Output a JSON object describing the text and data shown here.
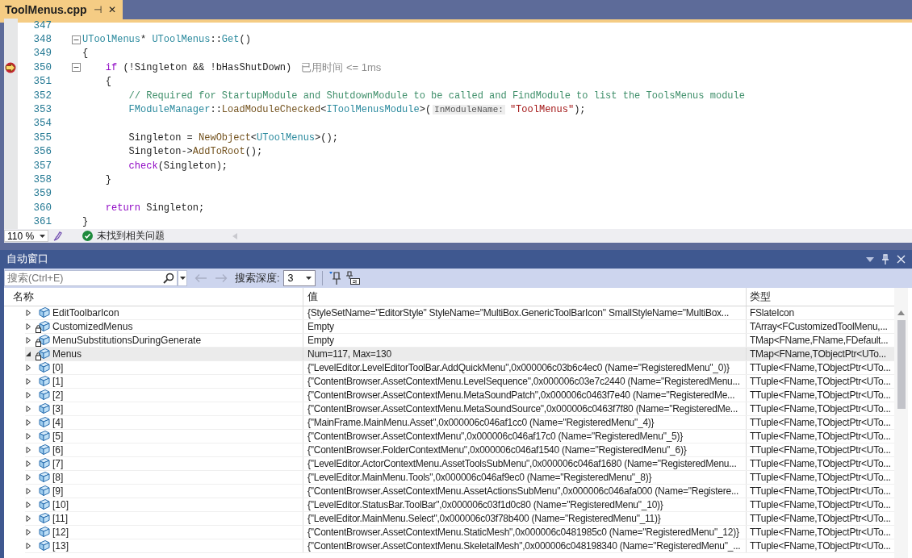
{
  "tab": {
    "title": "ToolMenus.cpp",
    "pin": "⊣",
    "close": "✕",
    "selected": true
  },
  "code": {
    "lines": [
      {
        "number": "347",
        "fold": false,
        "breakpoint": false
      },
      {
        "number": "348",
        "fold": true,
        "breakpoint": false,
        "tokens": [
          {
            "text": "UToolMenus",
            "kind": "type"
          },
          {
            "text": "* ",
            "kind": "plain"
          },
          {
            "text": "UToolMenus",
            "kind": "type"
          },
          {
            "text": "::",
            "kind": "plain"
          },
          {
            "text": "Get",
            "kind": "type"
          },
          {
            "text": "()",
            "kind": "plain"
          }
        ]
      },
      {
        "number": "349",
        "fold": false,
        "breakpoint": false,
        "tokens": [
          {
            "text": "{",
            "kind": "plain"
          }
        ]
      },
      {
        "number": "350",
        "fold": true,
        "breakpoint": true,
        "tokens": [
          {
            "text": "\tif",
            "kind": "keyword"
          },
          {
            "text": " (!Singleton && !bHasShutDown)",
            "kind": "plain"
          },
          {
            "text": "已用时间 <= 1ms",
            "kind": "timing"
          }
        ]
      },
      {
        "number": "351",
        "fold": false,
        "breakpoint": false,
        "tokens": [
          {
            "text": "\t{",
            "kind": "plain"
          }
        ]
      },
      {
        "number": "352",
        "fold": false,
        "breakpoint": false,
        "tokens": [
          {
            "text": "\t\t// Required for StartupModule and ShutdownModule to be called and FindModule to list the ToolsMenus module",
            "kind": "comment"
          }
        ]
      },
      {
        "number": "353",
        "fold": false,
        "breakpoint": false,
        "tokens": [
          {
            "text": "\t\tFModuleManager",
            "kind": "type"
          },
          {
            "text": "::",
            "kind": "plain"
          },
          {
            "text": "LoadModuleChecked",
            "kind": "func"
          },
          {
            "text": "<",
            "kind": "plain"
          },
          {
            "text": "IToolMenusModule",
            "kind": "type"
          },
          {
            "text": ">(",
            "kind": "plain"
          },
          {
            "text": "InModuleName:",
            "kind": "hint"
          },
          {
            "text": "\"ToolMenus\"",
            "kind": "string"
          },
          {
            "text": ");",
            "kind": "plain"
          }
        ]
      },
      {
        "number": "354",
        "fold": false,
        "breakpoint": false
      },
      {
        "number": "355",
        "fold": false,
        "breakpoint": false,
        "tokens": [
          {
            "text": "\t\tSingleton = ",
            "kind": "plain"
          },
          {
            "text": "NewObject",
            "kind": "func"
          },
          {
            "text": "<",
            "kind": "plain"
          },
          {
            "text": "UToolMenus",
            "kind": "type"
          },
          {
            "text": ">();",
            "kind": "plain"
          }
        ]
      },
      {
        "number": "356",
        "fold": false,
        "breakpoint": false,
        "tokens": [
          {
            "text": "\t\tSingleton->",
            "kind": "plain"
          },
          {
            "text": "AddToRoot",
            "kind": "func"
          },
          {
            "text": "();",
            "kind": "plain"
          }
        ]
      },
      {
        "number": "357",
        "fold": false,
        "breakpoint": false,
        "tokens": [
          {
            "text": "\t\tcheck",
            "kind": "keyword"
          },
          {
            "text": "(Singleton);",
            "kind": "plain"
          }
        ]
      },
      {
        "number": "358",
        "fold": false,
        "breakpoint": false,
        "tokens": [
          {
            "text": "\t}",
            "kind": "plain"
          }
        ]
      },
      {
        "number": "359",
        "fold": false,
        "breakpoint": false
      },
      {
        "number": "360",
        "fold": false,
        "breakpoint": false,
        "tokens": [
          {
            "text": "\treturn",
            "kind": "keyword"
          },
          {
            "text": " Singleton;",
            "kind": "plain"
          }
        ]
      },
      {
        "number": "361",
        "fold": false,
        "breakpoint": false,
        "tokens": [
          {
            "text": "}",
            "kind": "plain"
          }
        ]
      }
    ]
  },
  "editor_status": {
    "zoom": "110 %",
    "message": "未找到相关问题"
  },
  "auto_window": {
    "title": "自动窗口",
    "search": {
      "placeholder": "搜索(Ctrl+E)"
    },
    "depth_label": "搜索深度:",
    "depth": "3",
    "columns": [
      "名称",
      "值",
      "类型"
    ],
    "rows": [
      {
        "name": "EditToolbarIcon",
        "value": "{StyleSetName=\"EditorStyle\" StyleName=\"MultiBox.GenericToolBarIcon\" SmallStyleName=\"MultiBox...",
        "type": "FSlateIcon",
        "locked": false,
        "expanded": false,
        "selected": false
      },
      {
        "name": "CustomizedMenus",
        "value": "Empty",
        "type": "TArray<FCustomizedToolMenu,...",
        "locked": true,
        "expanded": false,
        "selected": false
      },
      {
        "name": "MenuSubstitutionsDuringGenerate",
        "value": "Empty",
        "type": "TMap<FName,FName,FDefault...",
        "locked": true,
        "expanded": false,
        "selected": false
      },
      {
        "name": "Menus",
        "value": "Num=117, Max=130",
        "type": "TMap<FName,TObjectPtr<UTo...",
        "locked": true,
        "expanded": true,
        "selected": true,
        "children": [
          {
            "name": "[0]",
            "value": "{\"LevelEditor.LevelEditorToolBar.AddQuickMenu\",0x000006c03b6c4ec0 (Name=\"RegisteredMenu\"_0)}",
            "type": "TTuple<FName,TObjectPtr<UTo...",
            "locked": false,
            "expanded": false,
            "selected": false
          },
          {
            "name": "[1]",
            "value": "{\"ContentBrowser.AssetContextMenu.LevelSequence\",0x000006c03e7c2440 (Name=\"RegisteredMenu...",
            "type": "TTuple<FName,TObjectPtr<UTo...",
            "locked": false,
            "expanded": false,
            "selected": false
          },
          {
            "name": "[2]",
            "value": "{\"ContentBrowser.AssetContextMenu.MetaSoundPatch\",0x000006c0463f7e40 (Name=\"RegisteredMe...",
            "type": "TTuple<FName,TObjectPtr<UTo...",
            "locked": false,
            "expanded": false,
            "selected": false
          },
          {
            "name": "[3]",
            "value": "{\"ContentBrowser.AssetContextMenu.MetaSoundSource\",0x000006c0463f7f80 (Name=\"RegisteredMe...",
            "type": "TTuple<FName,TObjectPtr<UTo...",
            "locked": false,
            "expanded": false,
            "selected": false
          },
          {
            "name": "[4]",
            "value": "{\"MainFrame.MainMenu.Asset\",0x000006c046af1cc0 (Name=\"RegisteredMenu\"_4)}",
            "type": "TTuple<FName,TObjectPtr<UTo...",
            "locked": false,
            "expanded": false,
            "selected": false
          },
          {
            "name": "[5]",
            "value": "{\"ContentBrowser.AssetContextMenu\",0x000006c046af17c0 (Name=\"RegisteredMenu\"_5)}",
            "type": "TTuple<FName,TObjectPtr<UTo...",
            "locked": false,
            "expanded": false,
            "selected": false
          },
          {
            "name": "[6]",
            "value": "{\"ContentBrowser.FolderContextMenu\",0x000006c046af1540 (Name=\"RegisteredMenu\"_6)}",
            "type": "TTuple<FName,TObjectPtr<UTo...",
            "locked": false,
            "expanded": false,
            "selected": false
          },
          {
            "name": "[7]",
            "value": "{\"LevelEditor.ActorContextMenu.AssetToolsSubMenu\",0x000006c046af1680 (Name=\"RegisteredMenu...",
            "type": "TTuple<FName,TObjectPtr<UTo...",
            "locked": false,
            "expanded": false,
            "selected": false
          },
          {
            "name": "[8]",
            "value": "{\"LevelEditor.MainMenu.Tools\",0x000006c046af9ec0 (Name=\"RegisteredMenu\"_8)}",
            "type": "TTuple<FName,TObjectPtr<UTo...",
            "locked": false,
            "expanded": false,
            "selected": false
          },
          {
            "name": "[9]",
            "value": "{\"ContentBrowser.AssetContextMenu.AssetActionsSubMenu\",0x000006c046afa000 (Name=\"Registere...",
            "type": "TTuple<FName,TObjectPtr<UTo...",
            "locked": false,
            "expanded": false,
            "selected": false
          },
          {
            "name": "[10]",
            "value": "{\"LevelEditor.StatusBar.ToolBar\",0x000006c03f1d0c80 (Name=\"RegisteredMenu\"_10)}",
            "type": "TTuple<FName,TObjectPtr<UTo...",
            "locked": false,
            "expanded": false,
            "selected": false
          },
          {
            "name": "[11]",
            "value": "{\"LevelEditor.MainMenu.Select\",0x000006c03f78b400 (Name=\"RegisteredMenu\"_11)}",
            "type": "TTuple<FName,TObjectPtr<UTo...",
            "locked": false,
            "expanded": false,
            "selected": false
          },
          {
            "name": "[12]",
            "value": "{\"ContentBrowser.AssetContextMenu.StaticMesh\",0x000006c0481985c0 (Name=\"RegisteredMenu\"_12)}",
            "type": "TTuple<FName,TObjectPtr<UTo...",
            "locked": false,
            "expanded": false,
            "selected": false
          },
          {
            "name": "[13]",
            "value": "{\"ContentBrowser.AssetContextMenu.SkeletalMesh\",0x000006c048198340 (Name=\"RegisteredMenu\"_...",
            "type": "TTuple<FName,TObjectPtr<UTo...",
            "locked": false,
            "expanded": false,
            "selected": false
          }
        ]
      }
    ]
  }
}
